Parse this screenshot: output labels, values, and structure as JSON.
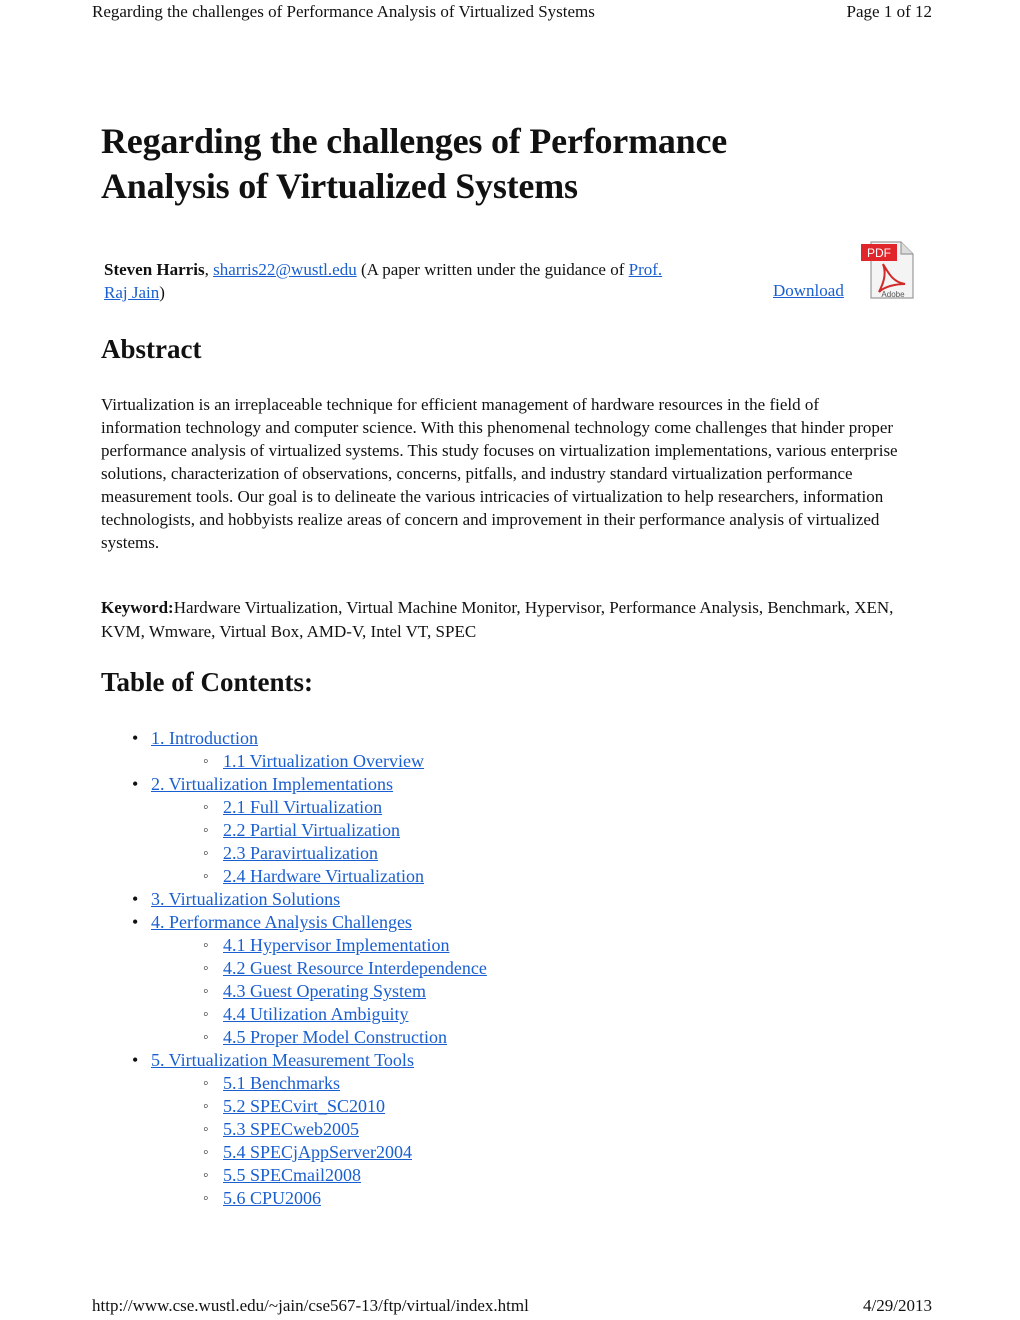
{
  "header": {
    "title": "Regarding the challenges of Performance Analysis of Virtualized Systems",
    "page": "Page 1 of 12"
  },
  "document": {
    "title": "Regarding the challenges of Performance Analysis of Virtualized Systems",
    "author": {
      "name": "Steven Harris",
      "sep": ", ",
      "email": "sharris22@wustl.edu",
      "note_pre": " (A paper written under the guidance of ",
      "advisor": "Prof. Raj Jain",
      "note_post": ")"
    },
    "download_label": "Download",
    "pdf_icon": "pdf-adobe-icon",
    "abstract_heading": "Abstract",
    "abstract_text": "Virtualization is an irreplaceable technique for efficient management of hardware resources in the field of information technology and computer science. With this phenomenal technology come challenges that hinder proper performance analysis of virtualized systems. This study focuses on virtualization implementations, various enterprise solutions, characterization of observations, concerns, pitfalls, and industry standard virtualization performance measurement tools. Our goal is to delineate the various intricacies of virtualization to help researchers, information technologists, and hobbyists realize areas of concern and improvement in their performance analysis of virtualized systems.",
    "keyword_label": "Keyword:",
    "keywords": "Hardware Virtualization, Virtual Machine Monitor, Hypervisor, Performance Analysis, Benchmark, XEN, KVM, Wmware, Virtual Box, AMD-V, Intel VT, SPEC",
    "toc_heading": "Table of Contents:",
    "toc": [
      {
        "label": "1. Introduction",
        "children": [
          {
            "label": "1.1 Virtualization Overview"
          }
        ]
      },
      {
        "label": "2. Virtualization Implementations",
        "children": [
          {
            "label": "2.1 Full Virtualization"
          },
          {
            "label": "2.2 Partial Virtualization"
          },
          {
            "label": "2.3 Paravirtualization"
          },
          {
            "label": "2.4 Hardware Virtualization"
          }
        ]
      },
      {
        "label": "3. Virtualization Solutions",
        "children": []
      },
      {
        "label": "4. Performance Analysis Challenges",
        "children": [
          {
            "label": "4.1 Hypervisor Implementation"
          },
          {
            "label": "4.2 Guest Resource Interdependence"
          },
          {
            "label": "4.3 Guest Operating System"
          },
          {
            "label": "4.4 Utilization Ambiguity"
          },
          {
            "label": "4.5 Proper Model Construction"
          }
        ]
      },
      {
        "label": "5. Virtualization Measurement Tools",
        "children": [
          {
            "label": "5.1 Benchmarks"
          },
          {
            "label": "5.2 SPECvirt_SC2010"
          },
          {
            "label": "5.3 SPECweb2005"
          },
          {
            "label": "5.4 SPECjAppServer2004"
          },
          {
            "label": "5.5 SPECmail2008"
          },
          {
            "label": "5.6 CPU2006"
          }
        ]
      }
    ]
  },
  "footer": {
    "url": "http://www.cse.wustl.edu/~jain/cse567-13/ftp/virtual/index.html",
    "date": "4/29/2013"
  },
  "colors": {
    "link": "#1a5fd0",
    "text": "#111111",
    "pdf_red": "#e0262b"
  }
}
